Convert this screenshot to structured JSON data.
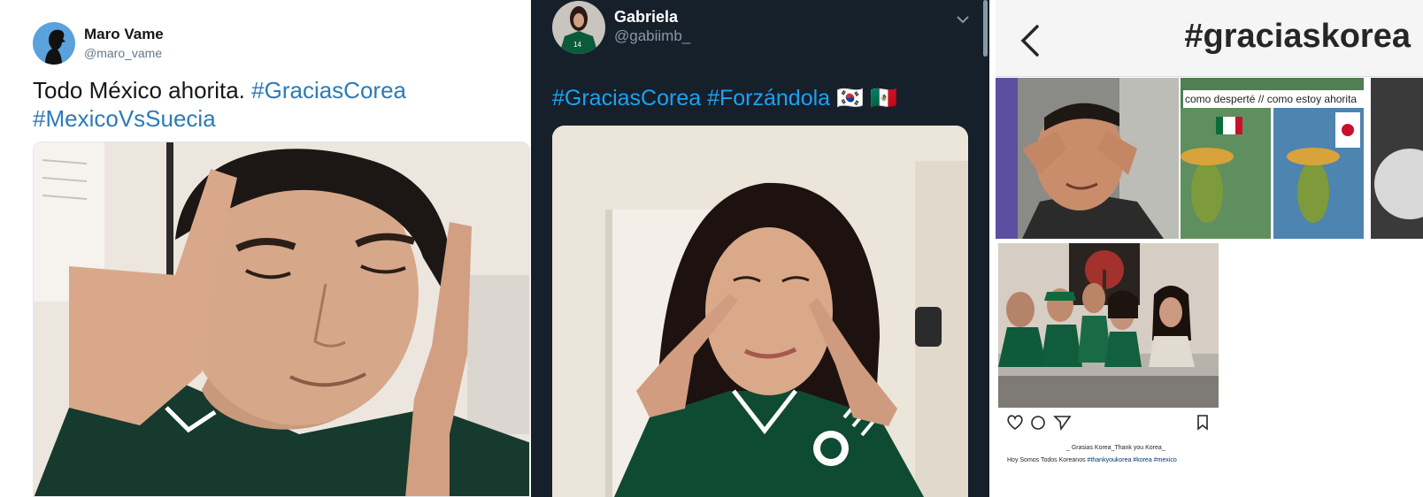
{
  "tweet_light": {
    "name": "Maro Vame",
    "handle": "@maro_vame",
    "text_plain": "Todo México ahorita. ",
    "hashtag_1": "#GraciasCorea",
    "hashtag_2": "#MexicoVsSuecia",
    "avatar_icon": "silhouette-avatar-icon"
  },
  "tweet_dark": {
    "name": "Gabriela",
    "handle": "@gabiimb_",
    "hashtag_1": "#GraciasCorea",
    "hashtag_2": "#Forzándola",
    "flags": "🇰🇷 🇲🇽",
    "menu_icon": "chevron-down-icon"
  },
  "instagram": {
    "title": "#graciaskorea",
    "back_icon": "chevron-left-icon",
    "meme_caption": "como desperté // como estoy ahorita",
    "caption_line1": "_ Grasias Korea_Thank you Korea_",
    "caption_line2_plain": "Hoy Somos Todos Koreanos ",
    "caption_tags": "#thankyoukorea #korea #mexico",
    "action_icons": [
      "heart-icon",
      "comment-icon",
      "share-icon",
      "bookmark-icon"
    ]
  },
  "colors": {
    "twitter_link": "#2b7bb9",
    "dark_bg": "#15202b",
    "dark_link": "#1da1f2",
    "mexico_green": "#0b5b3a"
  }
}
